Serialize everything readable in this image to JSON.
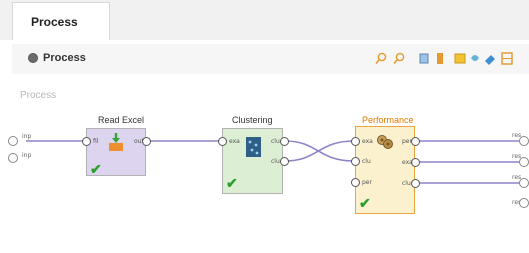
{
  "tabs": [
    {
      "label": "Process"
    }
  ],
  "breadcrumb": {
    "label": "Process"
  },
  "canvas": {
    "label": "Process"
  },
  "operators": {
    "read_excel": {
      "title": "Read Excel",
      "ports_in": [
        "fil"
      ],
      "ports_out": [
        "out"
      ]
    },
    "clustering": {
      "title": "Clustering",
      "ports_in": [
        "exa"
      ],
      "ports_out": [
        "clu",
        "clu"
      ]
    },
    "performance": {
      "title": "Performance",
      "ports_in": [
        "exa",
        "clu",
        "per"
      ],
      "ports_out": [
        "per",
        "exa",
        "clu"
      ]
    }
  },
  "process_inputs": [
    "inp",
    "inp"
  ],
  "process_outputs": [
    "res",
    "res",
    "res",
    "res"
  ],
  "toolbar_icons": [
    "zoom-in-icon",
    "zoom-out-icon",
    "auto-wire-icon",
    "arrange-icon",
    "highlight-icon",
    "reorder-icon",
    "eraser-icon",
    "fit-view-icon"
  ],
  "colors": {
    "performance_title": "#e07a00",
    "check": "#2e9e2e",
    "wire": "#8b84c9"
  }
}
